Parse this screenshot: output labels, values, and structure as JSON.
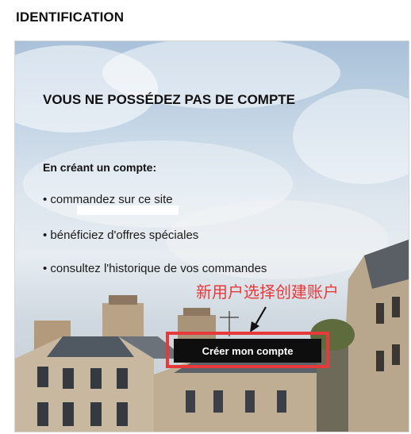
{
  "page": {
    "heading": "IDENTIFICATION"
  },
  "panel": {
    "title": "VOUS NE POSSÉDEZ PAS DE COMPTE",
    "subhead": "En créant un compte:",
    "benefits": [
      "• commandez sur ce site",
      "• bénéficiez d'offres spéciales",
      "• consultez l'historique de vos commandes"
    ],
    "cta_label": "Créer mon compte"
  },
  "annotation": {
    "text": "新用户选择创建账户",
    "color": "#e8393a"
  },
  "colors": {
    "cta_background": "#0e0e0e",
    "highlight": "#e8393a"
  }
}
